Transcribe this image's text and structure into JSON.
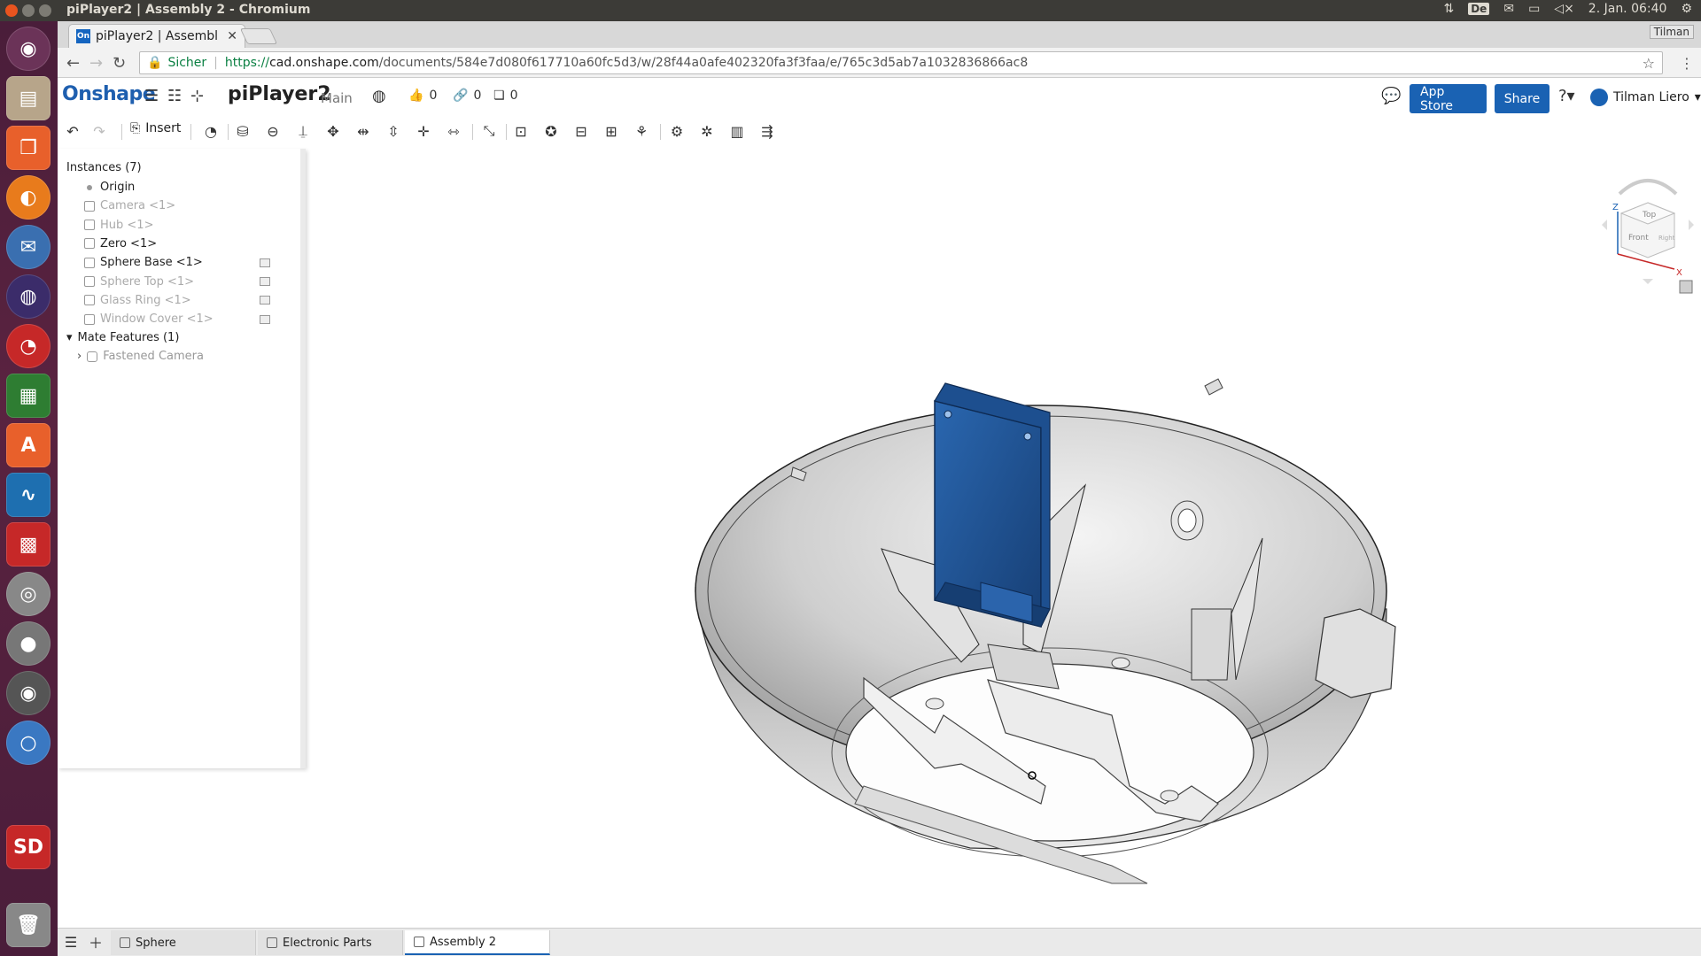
{
  "system_bar": {
    "window_title": "piPlayer2 | Assembly 2 - Chromium",
    "keyboard_layout": "De",
    "datetime": "2. Jan. 06:40"
  },
  "browser": {
    "tab_title": "piPlayer2 | Assembl",
    "tab_favicon": "On",
    "profile_name": "Tilman",
    "secure_label": "Sicher",
    "url_scheme": "https://",
    "url_host": "cad.onshape.com",
    "url_path": "/documents/584e7d080f617710a60fc5d3/w/28f44a0afe402320fa3f3faa/e/765c3d5ab7a1032836866ac8"
  },
  "onshape_header": {
    "logo": "Onshape",
    "document_title": "piPlayer2",
    "branch": "Main",
    "likes": "0",
    "links": "0",
    "copies": "0",
    "app_store_label": "App Store",
    "share_label": "Share",
    "user_name": "Tilman Liero"
  },
  "toolbar": {
    "insert_label": "Insert"
  },
  "instances_panel": {
    "header": "Instances (7)",
    "items": [
      {
        "label": "Origin",
        "dim": false,
        "icon": "origin-dot-icon"
      },
      {
        "label": "Camera <1>",
        "dim": true,
        "icon": "part-icon"
      },
      {
        "label": "Hub <1>",
        "dim": true,
        "icon": "part-icon"
      },
      {
        "label": "Zero <1>",
        "dim": false,
        "icon": "part-icon"
      },
      {
        "label": "Sphere Base <1>",
        "dim": false,
        "icon": "part-icon"
      },
      {
        "label": "Sphere Top <1>",
        "dim": true,
        "icon": "part-icon"
      },
      {
        "label": "Glass Ring <1>",
        "dim": true,
        "icon": "part-icon"
      },
      {
        "label": "Window Cover <1>",
        "dim": true,
        "icon": "part-icon"
      }
    ],
    "mate_header": "Mate Features (1)",
    "mate_item": "Fastened Camera"
  },
  "bottom_tabs": [
    {
      "label": "Sphere",
      "active": false
    },
    {
      "label": "Electronic Parts",
      "active": false
    },
    {
      "label": "Assembly 2",
      "active": true
    }
  ],
  "viewcube": {
    "top": "Top",
    "front": "Front",
    "right": "Right",
    "x": "X",
    "z": "Z"
  },
  "colors": {
    "accent": "#1a62b3",
    "launcher": "#5a2340",
    "topbar": "#3c3b37",
    "camera_blue": "#1b4f8e"
  }
}
